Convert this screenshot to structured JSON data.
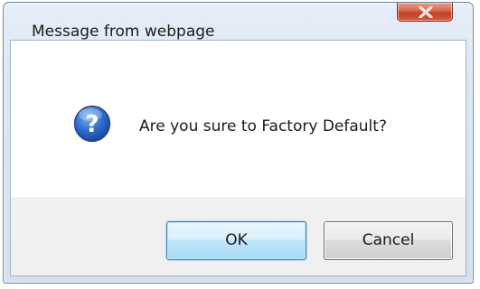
{
  "window": {
    "title": "Message from webpage"
  },
  "titlebar": {
    "close_icon": "close-icon"
  },
  "message": {
    "icon": "question-icon",
    "text": "Are you sure to Factory Default?"
  },
  "buttons": {
    "ok_label": "OK",
    "cancel_label": "Cancel"
  },
  "colors": {
    "close_button": "#c74b35",
    "ok_button_border": "#3c7fb1",
    "question_icon": "#2a66c4"
  }
}
